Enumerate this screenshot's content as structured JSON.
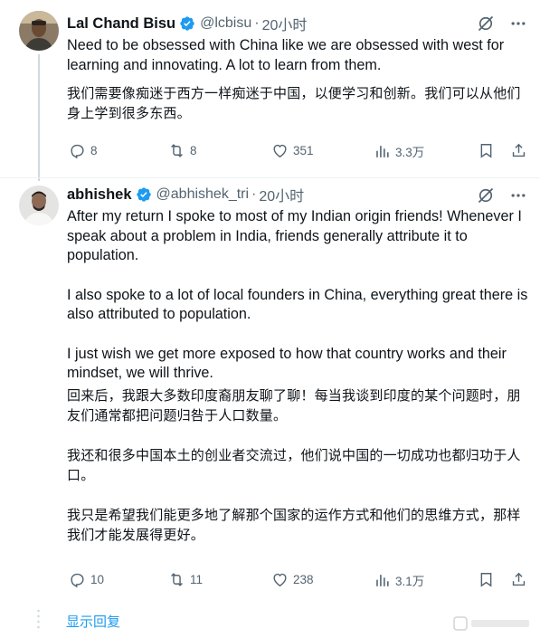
{
  "tweets": [
    {
      "name": "Lal Chand Bisu",
      "handle": "@lcbisu",
      "dot": "·",
      "time": "20小时",
      "paragraphs_en": [
        "Need to be obsessed with China like we are obsessed with west for learning and innovating. A lot to learn from them."
      ],
      "paragraphs_zh": [
        "我们需要像痴迷于西方一样痴迷于中国，以便学习和创新。我们可以从他们身上学到很多东西。"
      ],
      "stats": {
        "replies": "8",
        "reposts": "8",
        "likes": "351",
        "views": "3.3万"
      }
    },
    {
      "name": "abhishek",
      "handle": "@abhishek_tri",
      "dot": "·",
      "time": "20小时",
      "paragraphs_en": [
        "After my return I spoke to most of my Indian origin friends! Whenever I speak about a problem in India, friends generally attribute it to population.",
        "I also spoke to a lot of local founders in China, everything great there is also attributed to population.",
        "I just wish we get more exposed to how that country works and their mindset, we will thrive."
      ],
      "paragraphs_zh": [
        "回来后，我跟大多数印度裔朋友聊了聊！每当我谈到印度的某个问题时，朋友们通常都把问题归咎于人口数量。",
        "我还和很多中国本土的创业者交流过，他们说中国的一切成功也都归功于人口。",
        "我只是希望我们能更多地了解那个国家的运作方式和他们的思维方式，那样我们才能发展得更好。"
      ],
      "stats": {
        "replies": "10",
        "reposts": "11",
        "likes": "238",
        "views": "3.1万"
      }
    }
  ],
  "show_replies": "显示回复",
  "icons": {
    "verified": "verified-badge-icon",
    "grok": "grok-icon",
    "more": "more-icon",
    "reply": "reply-icon",
    "repost": "repost-icon",
    "like": "heart-icon",
    "views": "views-icon",
    "bookmark": "bookmark-icon",
    "share": "share-icon"
  },
  "colors": {
    "accent": "#1d9bf0",
    "secondary_text": "#536471",
    "text": "#0f1419"
  }
}
